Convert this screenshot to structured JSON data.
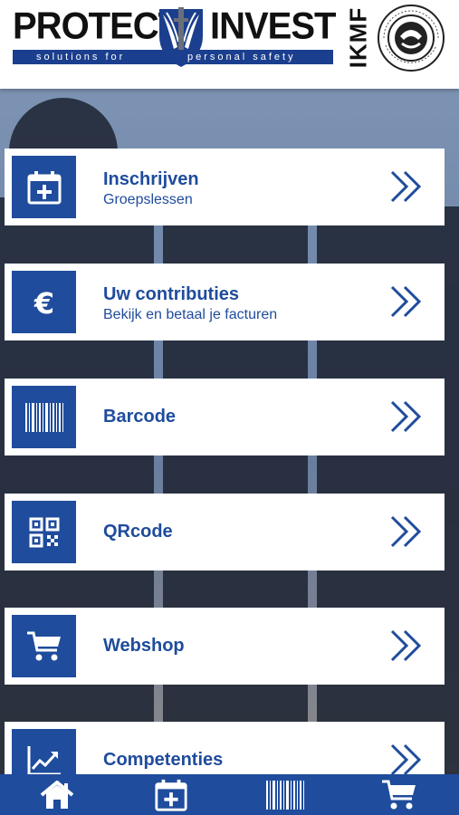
{
  "header": {
    "brand_left": "PROTECT",
    "brand_right": "INVEST",
    "tagline_left": "solutions for",
    "tagline_right": "personal safety",
    "ikmf": "IKMF"
  },
  "colors": {
    "primary": "#1f4c9c",
    "card_bg": "#ffffff"
  },
  "menu": [
    {
      "title": "Inschrijven",
      "subtitle": "Groepslessen",
      "icon": "calendar-plus-icon"
    },
    {
      "title": "Uw contributies",
      "subtitle": "Bekijk en betaal je facturen",
      "icon": "euro-icon"
    },
    {
      "title": "Barcode",
      "subtitle": "",
      "icon": "barcode-icon"
    },
    {
      "title": "QRcode",
      "subtitle": "",
      "icon": "qrcode-icon"
    },
    {
      "title": "Webshop",
      "subtitle": "",
      "icon": "cart-icon"
    },
    {
      "title": "Competenties",
      "subtitle": "",
      "icon": "trend-chart-icon"
    }
  ],
  "bottom_nav": [
    "home-icon",
    "calendar-plus-icon",
    "barcode-icon",
    "cart-icon"
  ]
}
